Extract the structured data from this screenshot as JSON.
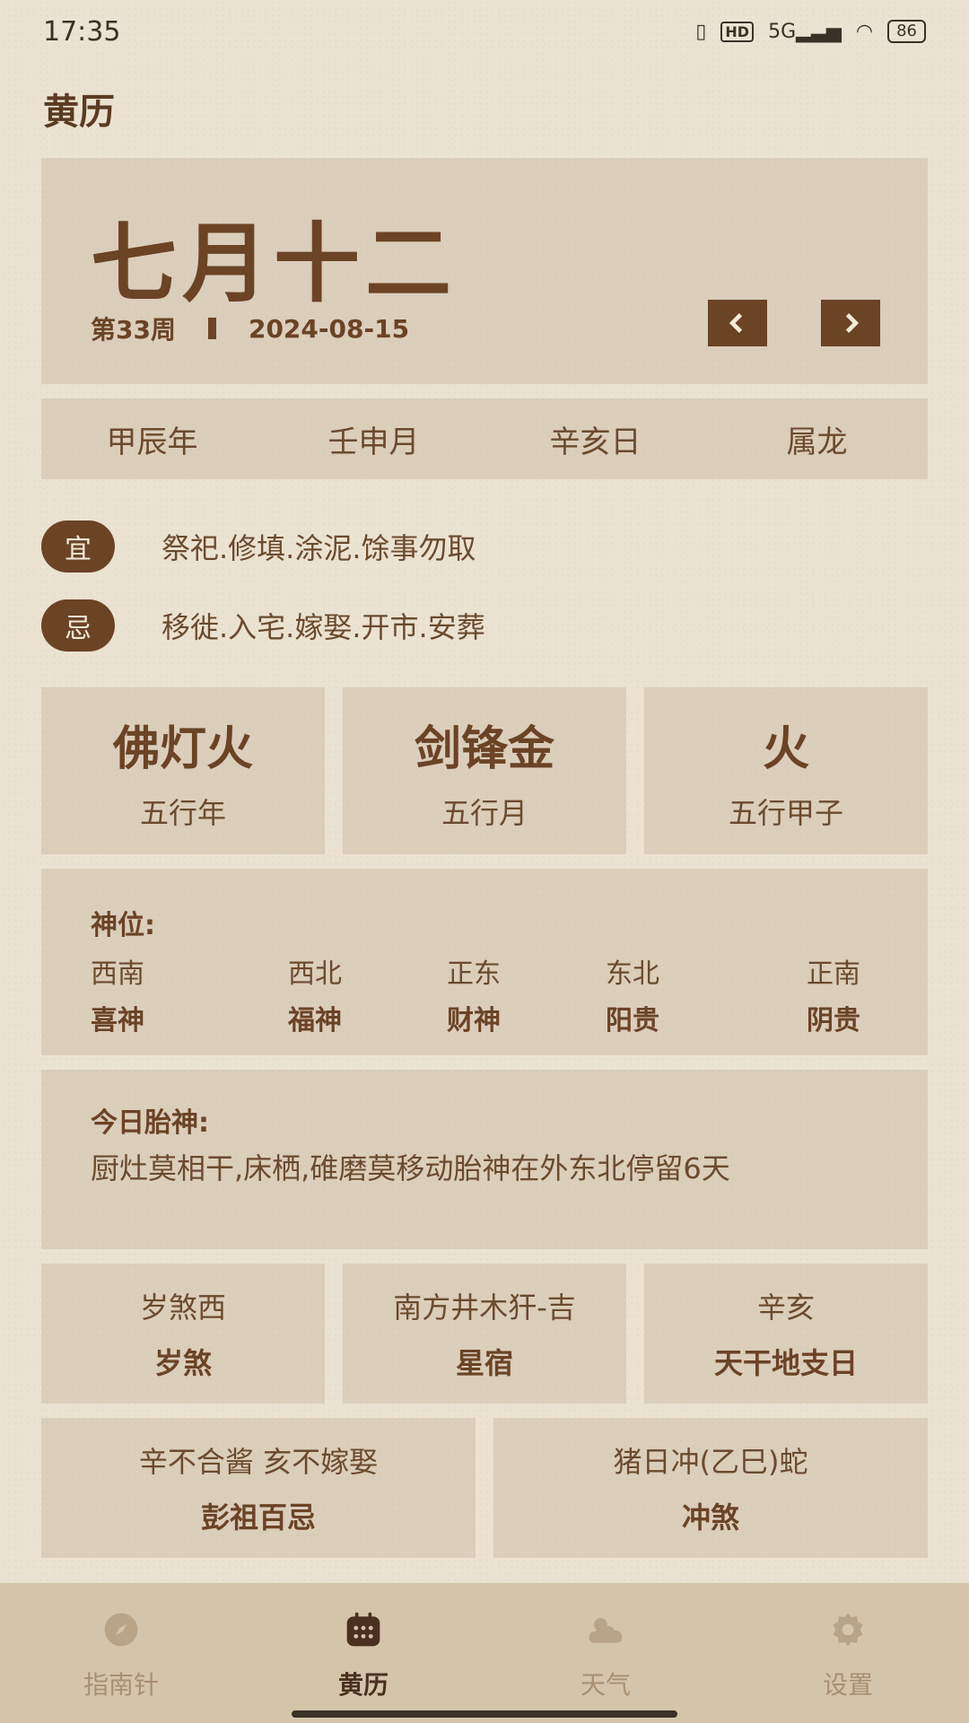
{
  "status": {
    "time": "17:35",
    "network": "5G",
    "hd": "HD",
    "battery": "86"
  },
  "app_title": "黄历",
  "date_card": {
    "lunar_date": "七月十二",
    "week": "第33周",
    "date": "2024-08-15"
  },
  "ganzhi": [
    "甲辰年",
    "壬申月",
    "辛亥日",
    "属龙"
  ],
  "yi": {
    "badge": "宜",
    "text": "祭祀.修填.涂泥.馀事勿取"
  },
  "ji": {
    "badge": "忌",
    "text": "移徙.入宅.嫁娶.开市.安葬"
  },
  "wuxing": [
    {
      "value": "佛灯火",
      "label": "五行年"
    },
    {
      "value": "剑锋金",
      "label": "五行月"
    },
    {
      "value": "火",
      "label": "五行甲子"
    }
  ],
  "shenwei": {
    "title": "神位:",
    "items": [
      {
        "direction": "西南",
        "name": "喜神"
      },
      {
        "direction": "西北",
        "name": "福神"
      },
      {
        "direction": "正东",
        "name": "财神"
      },
      {
        "direction": "东北",
        "name": "阳贵"
      },
      {
        "direction": "正南",
        "name": "阴贵"
      }
    ]
  },
  "taishen": {
    "title": "今日胎神:",
    "text": "厨灶莫相干,床栖,碓磨莫移动胎神在外东北停留6天"
  },
  "info_row1": [
    {
      "value": "岁煞西",
      "label": "岁煞"
    },
    {
      "value": "南方井木犴-吉",
      "label": "星宿"
    },
    {
      "value": "辛亥",
      "label": "天干地支日"
    }
  ],
  "info_row2": [
    {
      "value": "辛不合酱 亥不嫁娶",
      "label": "彭祖百忌"
    },
    {
      "value": "猪日冲(乙巳)蛇",
      "label": "冲煞"
    }
  ],
  "tabs": [
    {
      "label": "指南针",
      "icon": "compass-icon",
      "active": false
    },
    {
      "label": "黄历",
      "icon": "calendar-icon",
      "active": true
    },
    {
      "label": "天气",
      "icon": "weather-icon",
      "active": false
    },
    {
      "label": "设置",
      "icon": "gear-icon",
      "active": false
    }
  ],
  "colors": {
    "accent": "#6b4325",
    "background": "#ebe2d2",
    "card": "#d9cbb5",
    "nav": "#d4c4aa"
  }
}
